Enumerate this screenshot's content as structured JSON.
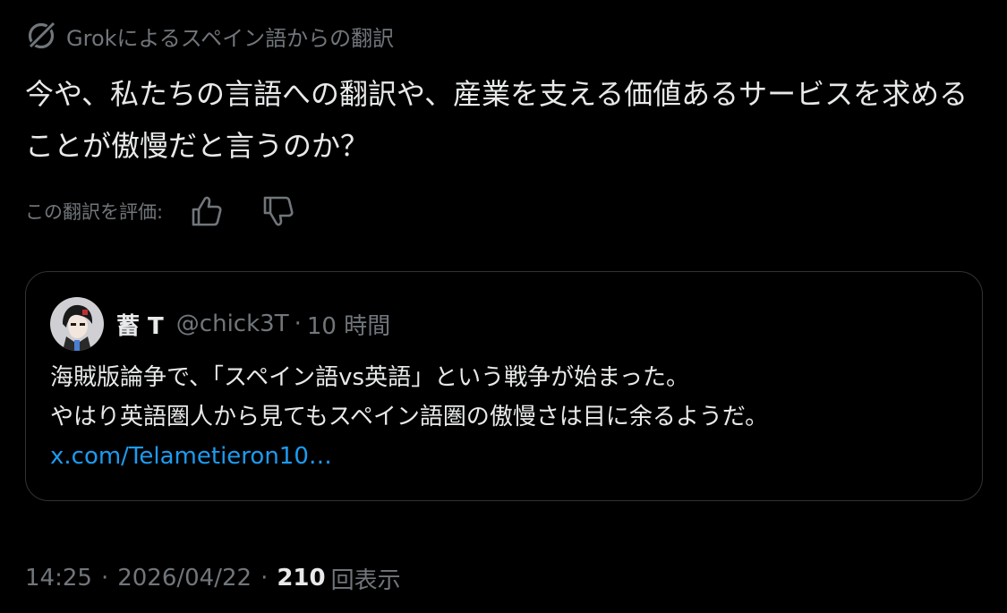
{
  "grok": {
    "label": "Grokによるスペイン語からの翻訳",
    "icon": "grok-logo-icon"
  },
  "translation": {
    "text": "今や、私たちの言語への翻訳や、産業を支える価値あるサービスを求めることが傲慢だと言うのか？"
  },
  "rating": {
    "label": "この翻訳を評価:",
    "up_icon": "thumbs-up-icon",
    "down_icon": "thumbs-down-icon"
  },
  "quote": {
    "name": "蓄 T",
    "handle": "@chick3T",
    "separator": "·",
    "time": "10 時間",
    "line1": "海賊版論争で、「スペイン語vs英語」という戦争が始まった。",
    "line2": "やはり英語圏人から見てもスペイン語圏の傲慢さは目に余るようだ。",
    "link": "x.com/Telametieron10…"
  },
  "footer": {
    "time": "14:25",
    "separator": "·",
    "date": "2026/04/22",
    "separator2": "·",
    "views": "210",
    "views_label": "回表示"
  },
  "colors": {
    "background": "#000000",
    "text": "#e7e9ea",
    "muted": "#71767b",
    "link": "#1d9bf0",
    "border": "#2f3336"
  }
}
